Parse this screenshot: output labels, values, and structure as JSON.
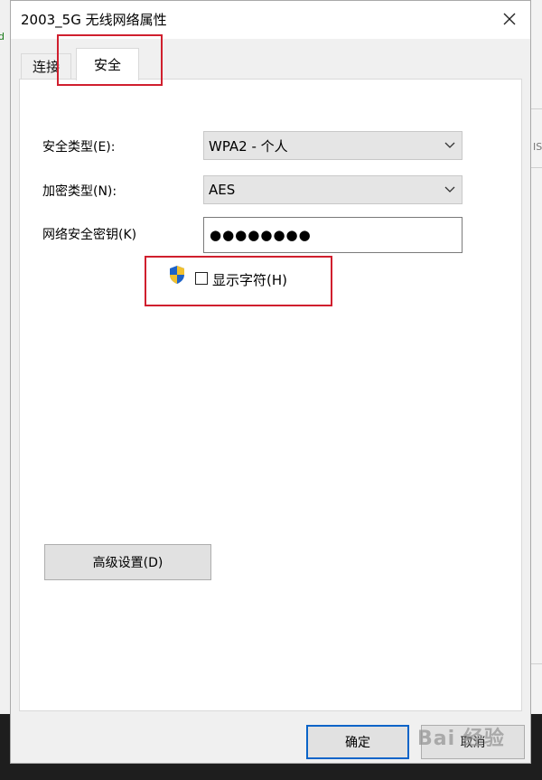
{
  "window": {
    "title": "2003_5G 无线网络属性"
  },
  "background": {
    "left_text": "d",
    "right_text": "IS"
  },
  "tabs": [
    {
      "label": "连接",
      "active": false
    },
    {
      "label": "安全",
      "active": true
    }
  ],
  "form": {
    "security_type": {
      "label": "安全类型(E):",
      "value": "WPA2 - 个人"
    },
    "encryption_type": {
      "label": "加密类型(N):",
      "value": "AES"
    },
    "network_key": {
      "label": "网络安全密钥(K)",
      "value": "●●●●●●●●"
    },
    "show_chars": {
      "label": "显示字符(H)",
      "checked": false
    }
  },
  "buttons": {
    "advanced": "高级设置(D)",
    "ok": "确定",
    "cancel": "取消"
  },
  "watermark": "Bai 经验",
  "colors": {
    "highlight": "#d01f2e",
    "default_button_border": "#0a64c8",
    "shield_blue": "#1e63c8",
    "shield_yellow": "#f2c12e"
  }
}
